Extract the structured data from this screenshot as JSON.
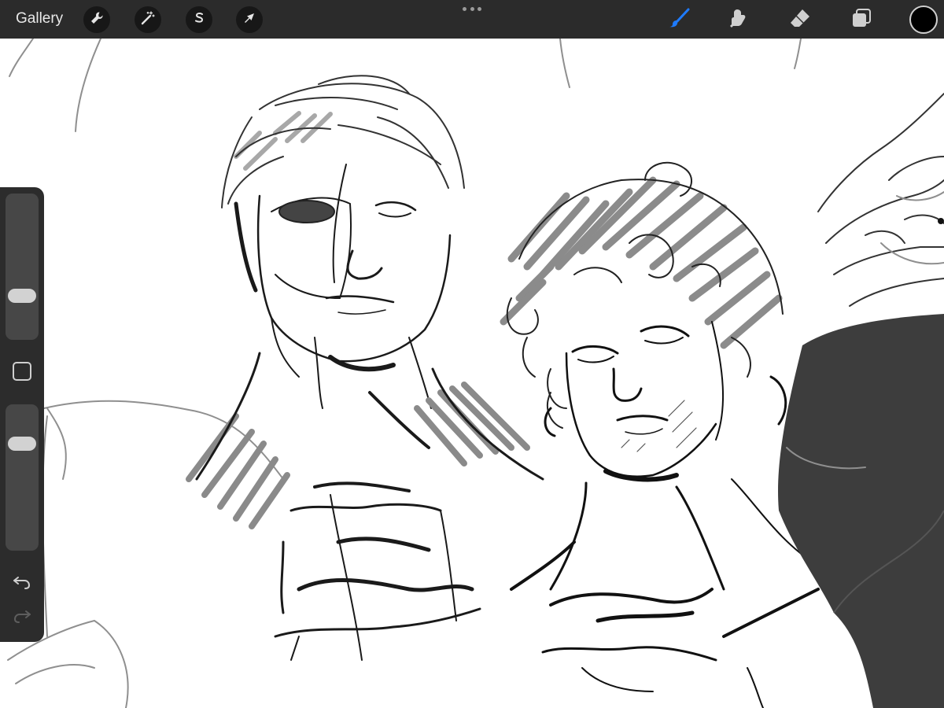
{
  "toolbar": {
    "gallery_label": "Gallery",
    "left_tools": [
      {
        "icon": "wrench-icon",
        "name": "actions"
      },
      {
        "icon": "magic-wand-icon",
        "name": "adjustments"
      },
      {
        "icon": "selection-s-icon",
        "name": "selection"
      },
      {
        "icon": "arrow-cursor-icon",
        "name": "transform"
      }
    ],
    "right_tools": [
      {
        "icon": "brush-icon",
        "name": "paint",
        "active": true
      },
      {
        "icon": "smudge-icon",
        "name": "smudge",
        "active": false
      },
      {
        "icon": "eraser-icon",
        "name": "eraser",
        "active": false
      },
      {
        "icon": "layers-icon",
        "name": "layers",
        "active": false
      }
    ],
    "current_color": "#000000",
    "active_tool_color": "#1e7bff"
  },
  "sidebar": {
    "brush_size_level": 0.27,
    "opacity_level": 0.77,
    "buttons": [
      "modify-icon",
      "undo-icon",
      "redo-icon"
    ]
  },
  "colors": {
    "toolbar_bg": "#2b2b2b",
    "canvas_bg": "#ffffff",
    "sidebar_bg": "#2c2c2c",
    "ink": "#111111",
    "shade": "#8a8a8a"
  }
}
